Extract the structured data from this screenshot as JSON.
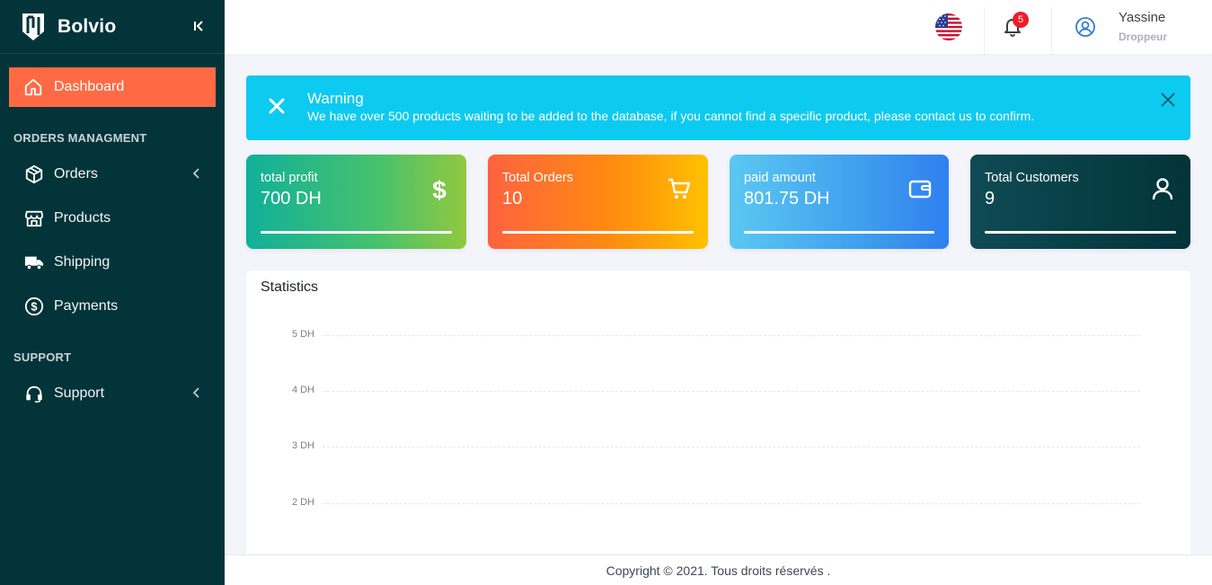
{
  "brand": {
    "name": "Bolvio"
  },
  "sidebar": {
    "active_item": {
      "label": "Dashboard",
      "icon": "home-icon"
    },
    "sections": [
      {
        "title": "ORDERS MANAGMENT"
      },
      {
        "title": "SUPPORT"
      }
    ],
    "items": [
      {
        "label": "Orders",
        "icon": "box-icon"
      },
      {
        "label": "Products",
        "icon": "store-icon"
      },
      {
        "label": "Shipping",
        "icon": "truck-icon"
      },
      {
        "label": "Payments",
        "icon": "dollar-circle-icon"
      },
      {
        "label": "Support",
        "icon": "headset-icon"
      }
    ]
  },
  "topbar": {
    "notification_count": "5",
    "user": {
      "name": "Yassine",
      "role": "Droppeur"
    }
  },
  "alert": {
    "title": "Warning",
    "message": "We have over 500 products waiting to be added to the database, if you cannot find a specific product, please contact us to confirm."
  },
  "cards": [
    {
      "label": "total profit",
      "value": "700 DH",
      "icon": "dollar-icon",
      "progress": 1.0
    },
    {
      "label": "Total Orders",
      "value": "10",
      "icon": "cart-icon",
      "progress": 1.0
    },
    {
      "label": "paid amount",
      "value": "801.75 DH",
      "icon": "wallet-icon",
      "progress": 1.0
    },
    {
      "label": "Total Customers",
      "value": "9",
      "icon": "user-icon",
      "progress": 1.0
    }
  ],
  "statistics": {
    "title": "Statistics",
    "y_ticks": [
      "5 DH",
      "4 DH",
      "3 DH",
      "2 DH"
    ]
  },
  "footer": {
    "text": "Copyright © 2021. Tous droits réservés ."
  },
  "colors": {
    "sidebar_bg": "#03343a",
    "active_nav": "#ff6a45",
    "alert_bg": "#0dcaf0",
    "badge": "#ee1c2a"
  }
}
